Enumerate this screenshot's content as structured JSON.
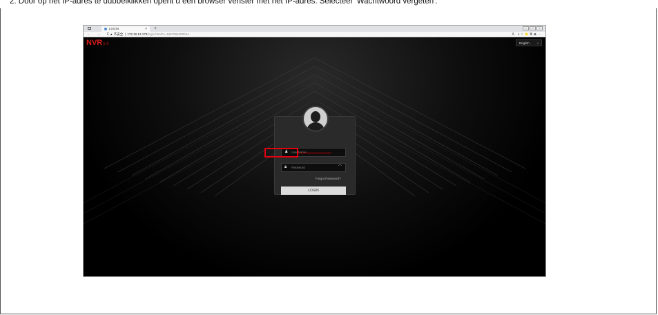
{
  "caption": "2. Door op het IP-adres te dubbelklikken opent u een browser venster met het IP-adres. Selecteer 'Wachtwoord vergeten'.",
  "browser": {
    "tab_title": "LOGIN",
    "tab_close": "×",
    "new_tab": "+",
    "url_warning": "▲ 不安全",
    "url_host": "172.16.12.173",
    "url_path": "/login.html?v=1657094000044",
    "nav": "← → C",
    "toolbar": "A٨ ☆ ⭐ ⧉ ☻ ···"
  },
  "app": {
    "logo_text": "NVR",
    "logo_version": "6.0",
    "language": "English",
    "username_placeholder": "UserName",
    "password_placeholder": "Password",
    "forgot_password": "Forgot Password?",
    "login_button": "LOGIN"
  },
  "colors": {
    "logo": "#d81d1d",
    "highlight": "#e3000f",
    "background": "#000000"
  }
}
